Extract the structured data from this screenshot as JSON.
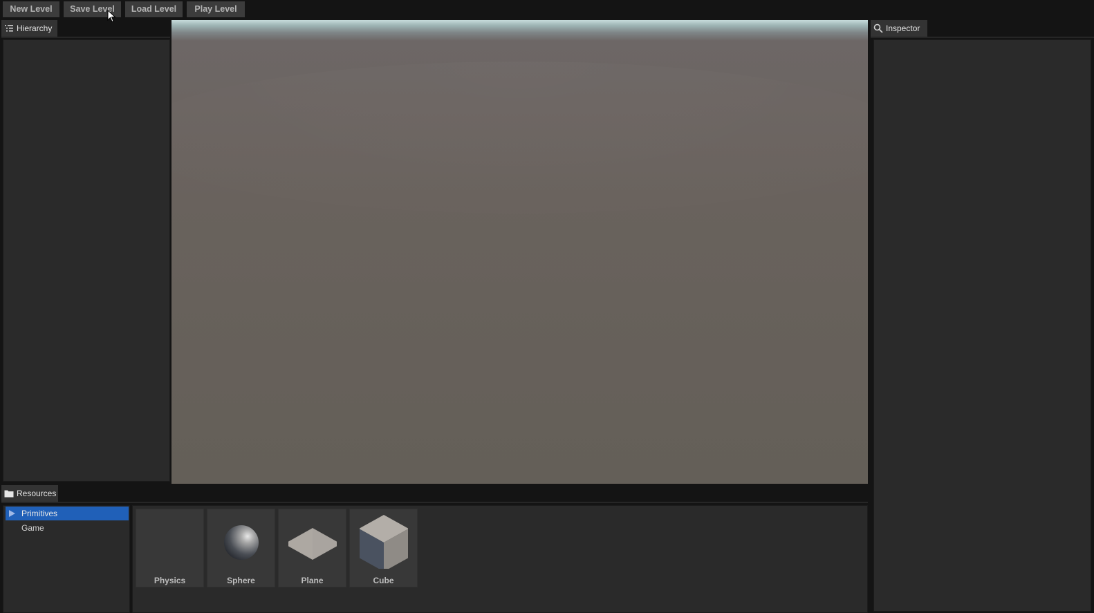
{
  "toolbar": {
    "new_level": "New Level",
    "save_level": "Save Level",
    "load_level": "Load Level",
    "play_level": "Play Level"
  },
  "hierarchy": {
    "title": "Hierarchy",
    "icon": "list-icon"
  },
  "inspector": {
    "title": "Inspector",
    "icon": "search-icon"
  },
  "resources": {
    "title": "Resources",
    "icon": "folder-icon",
    "tree": [
      {
        "label": "Primitives",
        "selected": true
      },
      {
        "label": "Game",
        "selected": false
      }
    ],
    "items": [
      {
        "label": "Physics",
        "icon": "none"
      },
      {
        "label": "Sphere",
        "icon": "sphere-icon"
      },
      {
        "label": "Plane",
        "icon": "plane-icon"
      },
      {
        "label": "Cube",
        "icon": "cube-icon"
      }
    ]
  },
  "colors": {
    "selection": "#2060b8",
    "panel_bg": "#2a2a2a",
    "app_bg": "#141414",
    "button_bg": "#3c3c3c"
  }
}
